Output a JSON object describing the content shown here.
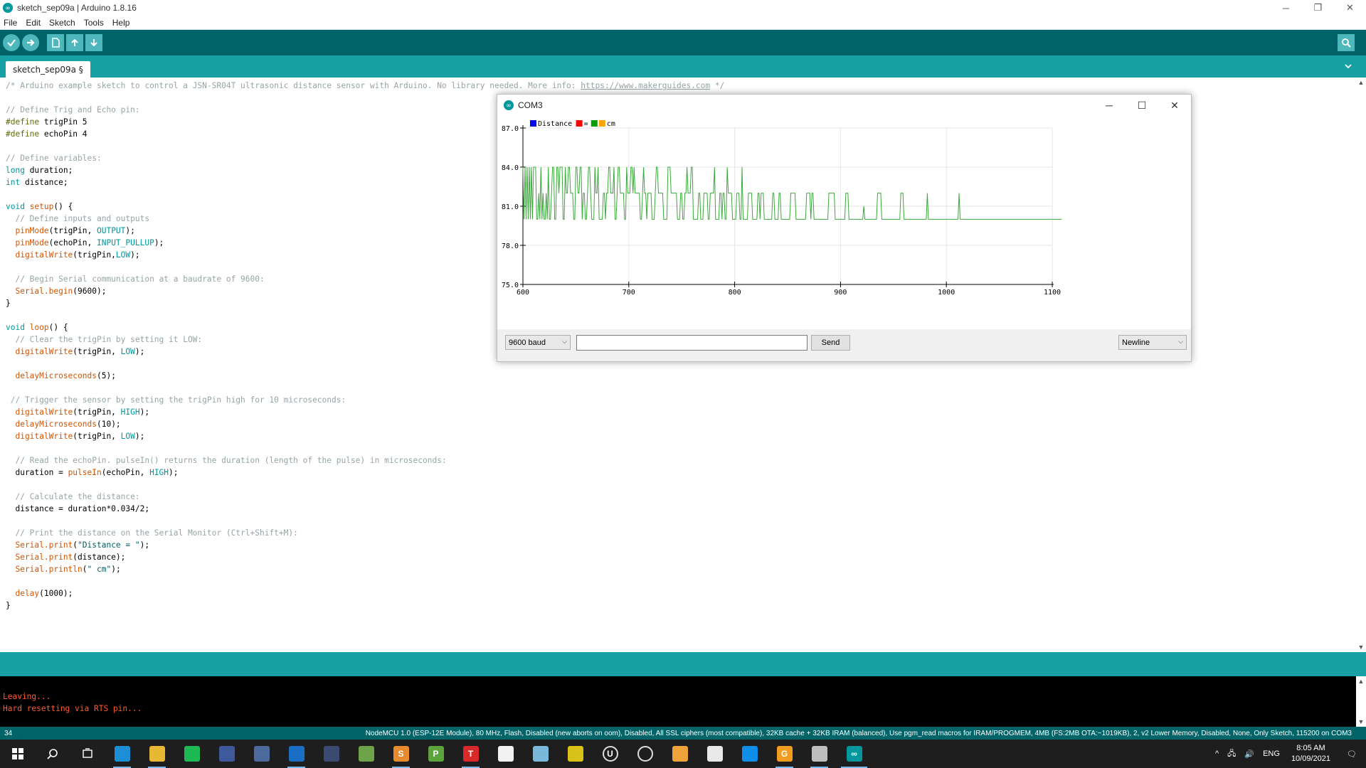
{
  "window": {
    "title": "sketch_sep09a | Arduino 1.8.16",
    "minimize": "─",
    "maximize": "❐",
    "close": "✕"
  },
  "menu": [
    "File",
    "Edit",
    "Sketch",
    "Tools",
    "Help"
  ],
  "toolbar": {
    "buttons": [
      "verify-icon",
      "upload-icon",
      "new-icon",
      "open-icon",
      "save-icon"
    ],
    "right_button": "serial-monitor-icon"
  },
  "tab": {
    "label": "sketch_sep09a §"
  },
  "code": [
    {
      "t": "/* Arduino example sketch to control a JSN-SR04T ultrasonic distance sensor with Arduino. No library needed. More info: ",
      "c": "comment",
      "link": "https://www.makerguides.com",
      "after": " */"
    },
    {
      "t": ""
    },
    {
      "t": "// Define Trig and Echo pin:",
      "c": "comment"
    },
    {
      "pp": "#define",
      "t": " trigPin 5"
    },
    {
      "pp": "#define",
      "t": " echoPin 4"
    },
    {
      "t": ""
    },
    {
      "t": "// Define variables:",
      "c": "comment"
    },
    {
      "kw": "long",
      "t": " duration;"
    },
    {
      "kw": "int",
      "t": " distance;"
    },
    {
      "t": ""
    },
    {
      "kw": "void",
      "fn": " setup",
      "t": "() {"
    },
    {
      "t": "  // Define inputs and outputs",
      "c": "comment"
    },
    {
      "fnlead": "  pinMode",
      "t": "(trigPin, ",
      "const": "OUTPUT",
      "tail": ");"
    },
    {
      "fnlead": "  pinMode",
      "t": "(echoPin, ",
      "const": "INPUT_PULLUP",
      "tail": ");"
    },
    {
      "fnlead": "  digitalWrite",
      "t": "(trigPin,",
      "const": "LOW",
      "tail": ");"
    },
    {
      "t": ""
    },
    {
      "t": "  // Begin Serial communication at a baudrate of 9600:",
      "c": "comment"
    },
    {
      "fnlead": "  Serial.begin",
      "t": "(9600);"
    },
    {
      "t": "}"
    },
    {
      "t": ""
    },
    {
      "kw": "void",
      "fn": " loop",
      "t": "() {"
    },
    {
      "t": "  // Clear the trigPin by setting it LOW:",
      "c": "comment"
    },
    {
      "fnlead": "  digitalWrite",
      "t": "(trigPin, ",
      "const": "LOW",
      "tail": ");"
    },
    {
      "t": ""
    },
    {
      "fnlead": "  delayMicroseconds",
      "t": "(5);"
    },
    {
      "t": ""
    },
    {
      "t": " // Trigger the sensor by setting the trigPin high for 10 microseconds:",
      "c": "comment"
    },
    {
      "fnlead": "  digitalWrite",
      "t": "(trigPin, ",
      "const": "HIGH",
      "tail": ");"
    },
    {
      "fnlead": "  delayMicroseconds",
      "t": "(10);"
    },
    {
      "fnlead": "  digitalWrite",
      "t": "(trigPin, ",
      "const": "LOW",
      "tail": ");"
    },
    {
      "t": ""
    },
    {
      "t": "  // Read the echoPin. pulseIn() returns the duration (length of the pulse) in microseconds:",
      "c": "comment"
    },
    {
      "t": "  duration = ",
      "fn2": "pulseIn",
      "t2": "(echoPin, ",
      "const": "HIGH",
      "tail": ");"
    },
    {
      "t": ""
    },
    {
      "t": "  // Calculate the distance:",
      "c": "comment"
    },
    {
      "t": "  distance = duration*0.034/2;"
    },
    {
      "t": ""
    },
    {
      "t": "  // Print the distance on the Serial Monitor (Ctrl+Shift+M):",
      "c": "comment"
    },
    {
      "fnlead": "  Serial.print",
      "t": "(",
      "str": "\"Distance = \"",
      "tail": ");"
    },
    {
      "fnlead": "  Serial.print",
      "t": "(distance);"
    },
    {
      "fnlead": "  Serial.println",
      "t": "(",
      "str": "\" cm\"",
      "tail": ");"
    },
    {
      "t": ""
    },
    {
      "fnlead": "  delay",
      "t": "(1000);"
    },
    {
      "t": "}"
    }
  ],
  "console": {
    "lines": [
      "Leaving...",
      "Hard resetting via RTS pin..."
    ]
  },
  "status": {
    "line": "34",
    "board": "NodeMCU 1.0 (ESP-12E Module), 80 MHz, Flash, Disabled (new aborts on oom), Disabled, All SSL ciphers (most compatible), 32KB cache + 32KB IRAM (balanced), Use pgm_read macros for IRAM/PROGMEM, 4MB (FS:2MB OTA:~1019KB), 2, v2 Lower Memory, Disabled, None, Only Sketch, 115200 on COM3"
  },
  "plotter": {
    "title": "COM3",
    "minimize": "─",
    "maximize": "☐",
    "close": "✕",
    "baud": "9600 baud",
    "send_label": "Send",
    "line_ending": "Newline"
  },
  "chart_data": {
    "type": "line",
    "xlim": [
      600,
      1100
    ],
    "ylim": [
      75.0,
      87.0
    ],
    "x_ticks": [
      "600",
      "700",
      "800",
      "900",
      "1000",
      "1100"
    ],
    "y_ticks": [
      "87.0",
      "84.0",
      "81.0",
      "78.0",
      "75.0"
    ],
    "grid": true,
    "legend": [
      {
        "label": "Distance",
        "color": "#0000ff"
      },
      {
        "label": "",
        "color": "#ff0000"
      },
      {
        "label": "=",
        "color": ""
      },
      {
        "label": "",
        "color": "#00a000"
      },
      {
        "label": "",
        "color": "#ffa500"
      },
      {
        "label": "cm",
        "color": ""
      }
    ],
    "series": [
      {
        "color": "#3aa83a",
        "x_start": 600,
        "x_step": 1,
        "values": [
          84,
          80,
          84,
          80,
          84,
          80,
          84,
          80,
          84,
          80,
          84,
          84,
          84,
          80,
          80,
          82,
          80,
          84,
          80,
          82,
          80,
          80,
          82,
          80,
          84,
          80,
          80,
          82,
          84,
          84,
          80,
          80,
          84,
          84,
          82,
          84,
          84,
          84,
          80,
          80,
          84,
          82,
          82,
          84,
          84,
          82,
          82,
          82,
          80,
          80,
          84,
          84,
          82,
          82,
          84,
          84,
          80,
          82,
          82,
          80,
          80,
          82,
          84,
          84,
          82,
          80,
          80,
          80,
          84,
          82,
          82,
          84,
          80,
          80,
          80,
          80,
          82,
          82,
          80,
          82,
          82,
          84,
          84,
          82,
          82,
          82,
          84,
          80,
          80,
          82,
          84,
          84,
          82,
          82,
          82,
          82,
          80,
          80,
          84,
          82,
          82,
          82,
          84,
          84,
          82,
          84,
          82,
          82,
          82,
          82,
          82,
          80,
          80,
          82,
          84,
          82,
          82,
          80,
          82,
          82,
          82,
          82,
          80,
          80,
          80,
          82,
          84,
          84,
          82,
          82,
          82,
          82,
          82,
          80,
          80,
          80,
          80,
          84,
          84,
          84,
          82,
          82,
          82,
          82,
          82,
          82,
          80,
          80,
          80,
          82,
          82,
          80,
          80,
          82,
          82,
          84,
          82,
          82,
          82,
          84,
          84,
          80,
          80,
          80,
          80,
          80,
          82,
          82,
          80,
          80,
          80,
          82,
          82,
          82,
          82,
          80,
          80,
          82,
          82,
          82,
          82,
          84,
          80,
          80,
          80,
          80,
          82,
          82,
          80,
          82,
          82,
          80,
          80,
          84,
          82,
          82,
          82,
          82,
          80,
          80,
          80,
          80,
          82,
          82,
          82,
          80,
          80,
          84,
          80,
          80,
          80,
          80,
          80,
          82,
          82,
          82,
          82,
          80,
          80,
          80,
          80,
          80,
          82,
          82,
          80,
          82,
          82,
          82,
          80,
          80,
          80,
          80,
          80,
          80,
          80,
          80,
          82,
          82,
          80,
          80,
          80,
          80,
          82,
          82,
          80,
          80,
          80,
          80,
          80,
          80,
          80,
          80,
          80,
          82,
          82,
          82,
          82,
          82,
          80,
          80,
          80,
          80,
          80,
          80,
          80,
          80,
          80,
          80,
          82,
          82,
          82,
          82,
          80,
          82,
          82,
          80,
          80,
          80,
          80,
          80,
          80,
          80,
          80,
          80,
          80,
          80,
          80,
          80,
          80,
          82,
          82,
          82,
          82,
          82,
          82,
          80,
          80,
          80,
          80,
          80,
          80,
          80,
          80,
          80,
          80,
          82,
          82,
          82,
          80,
          80,
          80,
          80,
          80,
          80,
          80,
          80,
          80,
          80,
          80,
          80,
          80,
          80,
          81,
          80,
          80,
          80,
          80,
          80,
          80,
          80,
          80,
          80,
          80,
          80,
          80,
          82,
          82,
          82,
          82,
          80,
          80,
          80,
          80,
          80,
          80,
          80,
          80,
          80,
          80,
          80,
          80,
          80,
          80,
          80,
          80,
          80,
          80,
          82,
          82,
          82,
          80,
          80,
          80,
          80,
          80,
          80,
          80,
          80,
          80,
          80,
          80,
          80,
          80,
          80,
          80,
          80,
          80,
          80,
          80,
          80,
          80,
          80,
          82,
          80,
          80,
          80,
          80,
          80,
          80,
          80,
          80,
          80,
          80,
          80,
          80,
          80,
          80,
          80,
          80,
          80,
          80,
          80,
          80,
          80,
          80,
          80,
          80,
          80,
          80,
          80,
          80,
          80,
          82,
          80,
          80,
          80,
          80,
          80,
          80,
          80,
          80,
          80,
          80,
          80,
          80,
          80,
          80,
          80,
          80,
          80,
          80,
          80,
          80,
          80,
          80,
          80,
          80,
          80,
          80,
          80,
          80,
          80,
          80,
          80,
          80,
          80,
          80,
          80,
          80,
          80,
          80,
          80,
          80,
          80,
          80,
          80,
          80,
          80,
          80,
          80,
          80,
          80,
          80,
          80,
          80,
          80,
          80,
          80,
          80,
          80,
          80,
          80,
          80,
          80,
          80,
          80,
          80,
          80,
          80,
          80,
          80,
          80,
          80,
          80,
          80,
          80,
          80,
          80,
          80,
          80,
          80,
          80,
          80,
          80,
          80,
          80,
          80,
          80,
          80,
          80,
          80,
          80,
          80,
          80,
          80,
          80,
          80,
          80,
          80,
          80
        ]
      }
    ]
  },
  "taskbar": {
    "apps": [
      {
        "name": "windows-start-icon",
        "color": "#1e1e1e",
        "glyph": ""
      },
      {
        "name": "search-icon",
        "color": "#1e1e1e",
        "glyph": ""
      },
      {
        "name": "task-view-icon",
        "color": "#1e1e1e",
        "glyph": ""
      },
      {
        "name": "edge-icon",
        "color": "#1c8fd6",
        "glyph": ""
      },
      {
        "name": "file-explorer-icon",
        "color": "#e8b733",
        "glyph": ""
      },
      {
        "name": "spotify-icon",
        "color": "#1db954",
        "glyph": ""
      },
      {
        "name": "app-blue-icon",
        "color": "#3f5a9c",
        "glyph": ""
      },
      {
        "name": "calculator-icon",
        "color": "#4d6a9c",
        "glyph": ""
      },
      {
        "name": "outlook-icon",
        "color": "#1a6fc4",
        "glyph": ""
      },
      {
        "name": "keepass-icon",
        "color": "#3a4a70",
        "glyph": ""
      },
      {
        "name": "app-green-icon",
        "color": "#6fa34a",
        "glyph": ""
      },
      {
        "name": "sublime-icon",
        "color": "#e88a2e",
        "glyph": "S"
      },
      {
        "name": "project-icon",
        "color": "#5ca33c",
        "glyph": "P"
      },
      {
        "name": "typora-icon",
        "color": "#d92a2a",
        "glyph": "T"
      },
      {
        "name": "document-icon",
        "color": "#f2f2f2",
        "glyph": ""
      },
      {
        "name": "notes-icon",
        "color": "#7ab8d9",
        "glyph": ""
      },
      {
        "name": "map-icon",
        "color": "#d8c21a",
        "glyph": ""
      },
      {
        "name": "upwork-icon",
        "color": "#1e1e1e",
        "glyph": "U"
      },
      {
        "name": "speedometer-icon",
        "color": "#1e1e1e",
        "glyph": ""
      },
      {
        "name": "app-orange-icon",
        "color": "#f0a23a",
        "glyph": ""
      },
      {
        "name": "database-icon",
        "color": "#e8e8e8",
        "glyph": ""
      },
      {
        "name": "teamviewer-icon",
        "color": "#0e8ee9",
        "glyph": ""
      },
      {
        "name": "app-g-icon",
        "color": "#f29c1f",
        "glyph": "G"
      },
      {
        "name": "app-box-icon",
        "color": "#bdbdbd",
        "glyph": ""
      },
      {
        "name": "arduino-icon",
        "color": "#00979c",
        "glyph": "∞"
      }
    ],
    "tray": {
      "chevron": "^",
      "network": "🖧",
      "volume": "🔊",
      "language": "ENG",
      "time": "8:05 AM",
      "date": "10/09/2021",
      "notification": "🗨"
    }
  }
}
